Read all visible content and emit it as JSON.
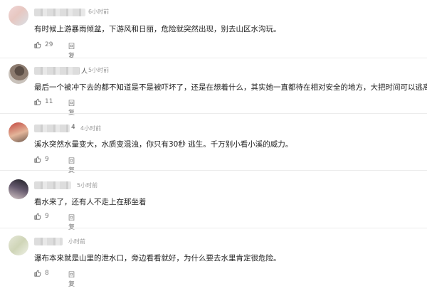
{
  "comments": [
    {
      "username_suffix": "",
      "time": "6小时前",
      "text": "有时候上游暴雨倾盆，下游风和日丽，危险就突然出现，别去山区水沟玩。",
      "likes": "29",
      "reply_label": "回复"
    },
    {
      "username_suffix": "人",
      "time": "5小时前",
      "text": "最后一个被冲下去的都不知道是不是被吓坏了，还是在想着什么，其实她一直都待在相对安全的地方，大把时间可以逃离的",
      "likes": "11",
      "reply_label": "回复"
    },
    {
      "username_suffix": "4",
      "time": "4小时前",
      "text": "溪水突然水量变大，水质变混浊，你只有30秒 逃生。千万别小看小溪的威力。",
      "likes": "9",
      "reply_label": "回复"
    },
    {
      "username_suffix": "",
      "time": "5小时前",
      "text": "看水来了，还有人不走上在那坐着",
      "likes": "9",
      "reply_label": "回复"
    },
    {
      "username_suffix": "",
      "time": "小时前",
      "text": "瀑布本来就是山里的泄水口，旁边看看就好，为什么要去水里肯定很危险。",
      "likes": "8",
      "reply_label": "回复"
    }
  ],
  "icons": {
    "like": "thumbs-up-icon",
    "emoji": "smiley-emoji-icon"
  }
}
